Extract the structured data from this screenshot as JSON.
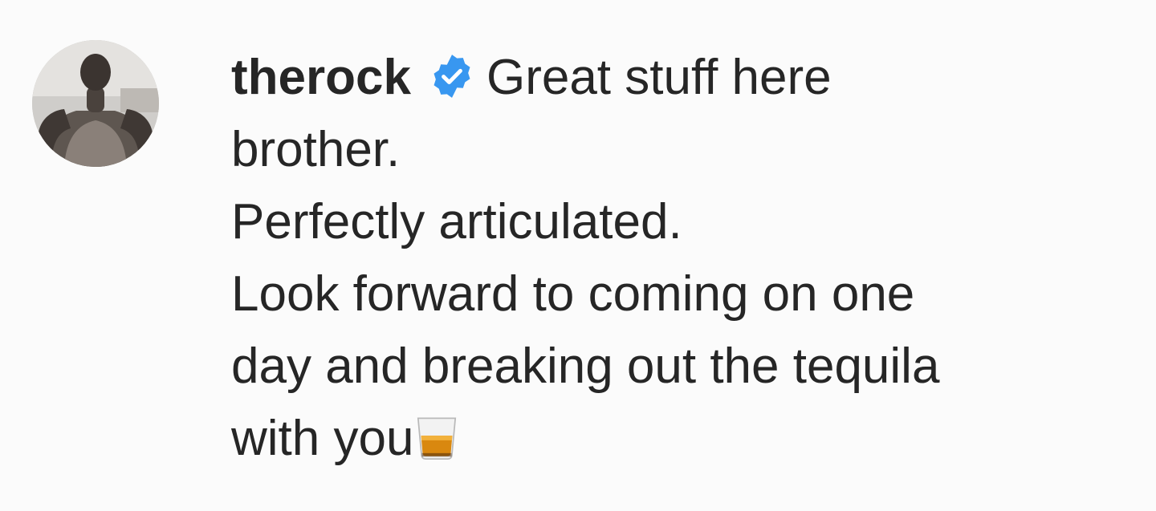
{
  "comment": {
    "username": "therock",
    "verified_icon": "verified-badge-icon",
    "avatar_icon": "profile-avatar",
    "text_lines": [
      "Great stuff here",
      "brother.",
      "Perfectly articulated.",
      "Look forward to coming on one",
      "day and breaking out the tequila",
      "with you"
    ],
    "trailing_emoji": "tumbler-glass-icon"
  },
  "colors": {
    "text": "#262626",
    "verified_blue": "#3897f0",
    "background": "#fbfbfb"
  }
}
